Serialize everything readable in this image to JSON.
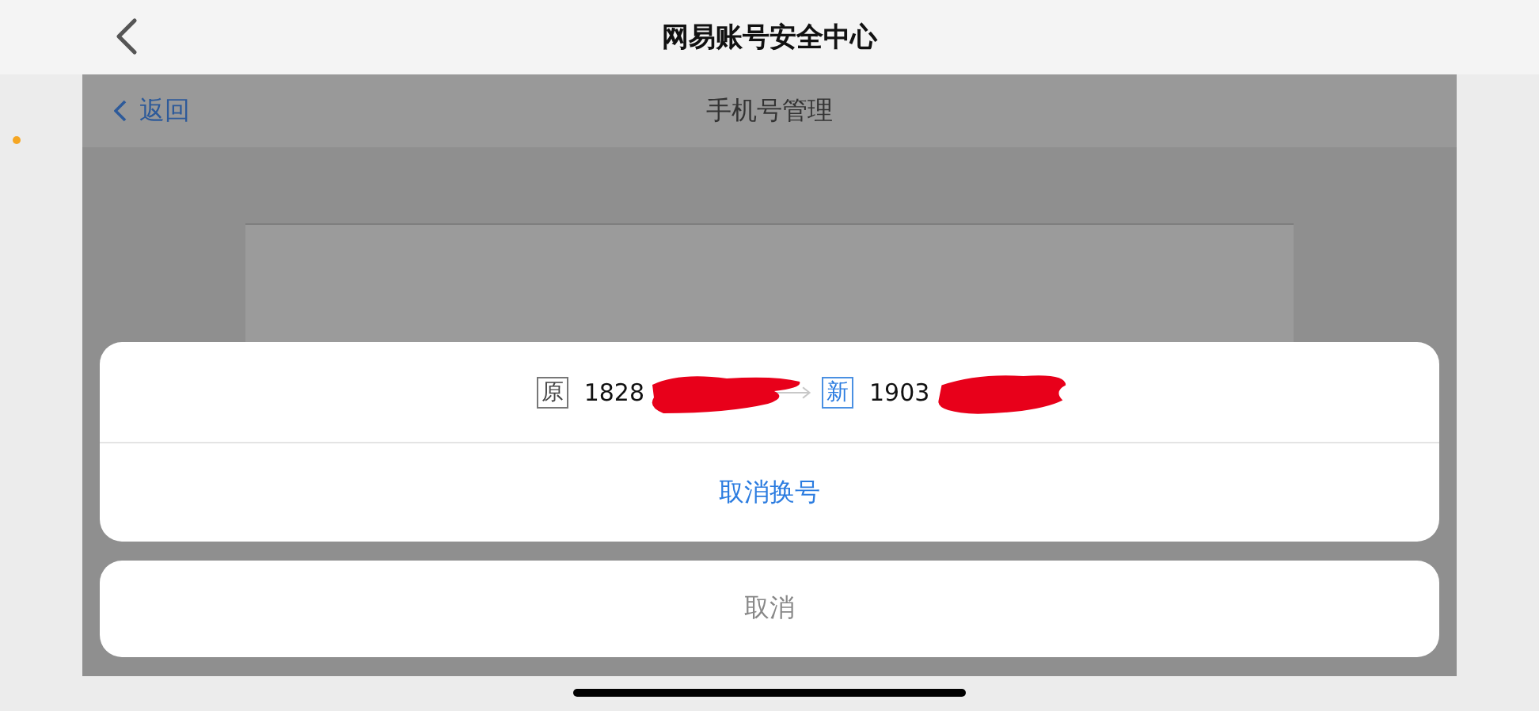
{
  "nav_bar": {
    "title": "网易账号安全中心"
  },
  "page": {
    "back_label": "返回",
    "title": "手机号管理"
  },
  "action_sheet": {
    "old_badge": "原",
    "old_number": "1828",
    "new_badge": "新",
    "new_number": "1903",
    "action": "取消换号",
    "cancel": "取消"
  }
}
